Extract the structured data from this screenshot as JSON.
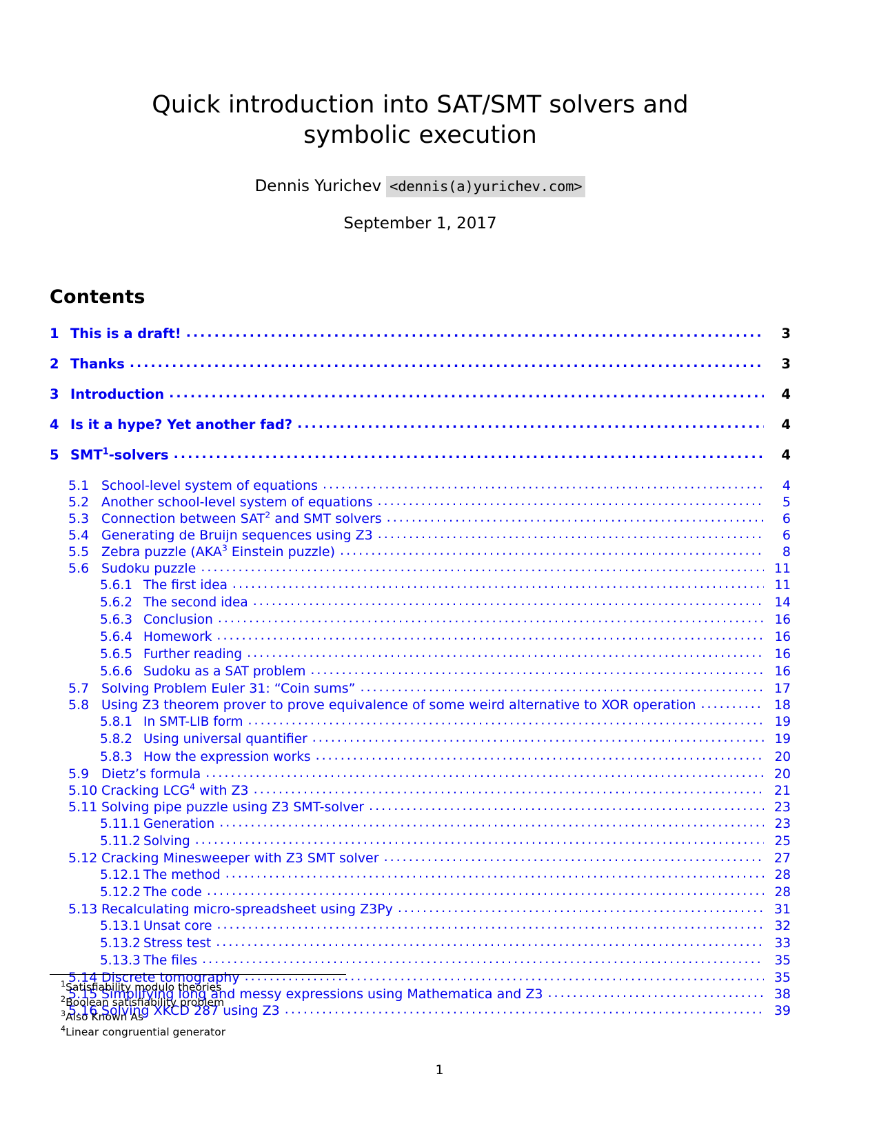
{
  "document": {
    "title": "Quick introduction into SAT/SMT solvers and symbolic execution",
    "author_name": "Dennis Yurichev",
    "author_email": "<dennis(a)yurichev.com>",
    "date": "September 1, 2017",
    "contents_heading": "Contents",
    "page_number": "1"
  },
  "toc": [
    {
      "level": 1,
      "num": "1",
      "label": "This is a draft!",
      "page": "3"
    },
    {
      "level": 1,
      "num": "2",
      "label": "Thanks",
      "page": "3"
    },
    {
      "level": 1,
      "num": "3",
      "label": "Introduction",
      "page": "4"
    },
    {
      "level": 1,
      "num": "4",
      "label": "Is it a hype?  Yet another fad?",
      "page": "4"
    },
    {
      "level": 1,
      "num": "5",
      "label": "SMT",
      "label_sup": "1",
      "label_tail": "-solvers",
      "page": "4"
    },
    {
      "level": 2,
      "num": "5.1",
      "label": "School-level system of equations",
      "page": "4"
    },
    {
      "level": 2,
      "num": "5.2",
      "label": "Another school-level system of equations",
      "page": "5"
    },
    {
      "level": 2,
      "num": "5.3",
      "label": "Connection between SAT",
      "label_sup": "2",
      "label_tail": " and SMT solvers",
      "page": "6"
    },
    {
      "level": 2,
      "num": "5.4",
      "label": "Generating de Bruijn sequences using Z3",
      "page": "6"
    },
    {
      "level": 2,
      "num": "5.5",
      "label": "Zebra puzzle (AKA",
      "label_sup": "3",
      "label_tail": " Einstein puzzle)",
      "page": "8"
    },
    {
      "level": 2,
      "num": "5.6",
      "label": "Sudoku puzzle",
      "page": "11"
    },
    {
      "level": 3,
      "num": "5.6.1",
      "label": "The first idea",
      "page": "11"
    },
    {
      "level": 3,
      "num": "5.6.2",
      "label": "The second idea",
      "page": "14"
    },
    {
      "level": 3,
      "num": "5.6.3",
      "label": "Conclusion",
      "page": "16"
    },
    {
      "level": 3,
      "num": "5.6.4",
      "label": "Homework",
      "page": "16"
    },
    {
      "level": 3,
      "num": "5.6.5",
      "label": "Further reading",
      "page": "16"
    },
    {
      "level": 3,
      "num": "5.6.6",
      "label": "Sudoku as a SAT problem",
      "page": "16"
    },
    {
      "level": 2,
      "num": "5.7",
      "label": "Solving Problem Euler 31: “Coin sums”",
      "page": "17"
    },
    {
      "level": 2,
      "num": "5.8",
      "label": "Using Z3 theorem prover to prove equivalence of some weird alternative to XOR operation",
      "page": "18"
    },
    {
      "level": 3,
      "num": "5.8.1",
      "label": "In SMT-LIB form",
      "page": "19"
    },
    {
      "level": 3,
      "num": "5.8.2",
      "label": "Using universal quantifier",
      "page": "19"
    },
    {
      "level": 3,
      "num": "5.8.3",
      "label": "How the expression works",
      "page": "20"
    },
    {
      "level": 2,
      "num": "5.9",
      "label": "Dietz’s formula",
      "page": "20"
    },
    {
      "level": 2,
      "num": "5.10",
      "label": "Cracking LCG",
      "label_sup": "4",
      "label_tail": " with Z3",
      "page": "21"
    },
    {
      "level": 2,
      "num": "5.11",
      "label": "Solving pipe puzzle using Z3 SMT-solver",
      "page": "23"
    },
    {
      "level": 3,
      "num": "5.11.1",
      "label": "Generation",
      "page": "23"
    },
    {
      "level": 3,
      "num": "5.11.2",
      "label": "Solving",
      "page": "25"
    },
    {
      "level": 2,
      "num": "5.12",
      "label": "Cracking Minesweeper with Z3 SMT solver",
      "page": "27"
    },
    {
      "level": 3,
      "num": "5.12.1",
      "label": "The method",
      "page": "28"
    },
    {
      "level": 3,
      "num": "5.12.2",
      "label": "The code",
      "page": "28"
    },
    {
      "level": 2,
      "num": "5.13",
      "label": "Recalculating micro-spreadsheet using Z3Py",
      "page": "31"
    },
    {
      "level": 3,
      "num": "5.13.1",
      "label": "Unsat core",
      "page": "32"
    },
    {
      "level": 3,
      "num": "5.13.2",
      "label": "Stress test",
      "page": "33"
    },
    {
      "level": 3,
      "num": "5.13.3",
      "label": "The files",
      "page": "35"
    },
    {
      "level": 2,
      "num": "5.14",
      "label": "Discrete tomography",
      "page": "35"
    },
    {
      "level": 2,
      "num": "5.15",
      "label": "Simplifying long and messy expressions using Mathematica and Z3",
      "page": "38"
    },
    {
      "level": 2,
      "num": "5.16",
      "label": "Solving XKCD 287 using Z3",
      "page": "39"
    }
  ],
  "footnotes": [
    {
      "marker": "1",
      "text": "Satisfiability modulo theories"
    },
    {
      "marker": "2",
      "text": "Boolean satisfiability problem"
    },
    {
      "marker": "3",
      "text": "Also Known As"
    },
    {
      "marker": "4",
      "text": "Linear congruential generator"
    }
  ],
  "colors": {
    "link": "#0000ee",
    "text": "#000000",
    "email_highlight": "#d9d9d9"
  }
}
